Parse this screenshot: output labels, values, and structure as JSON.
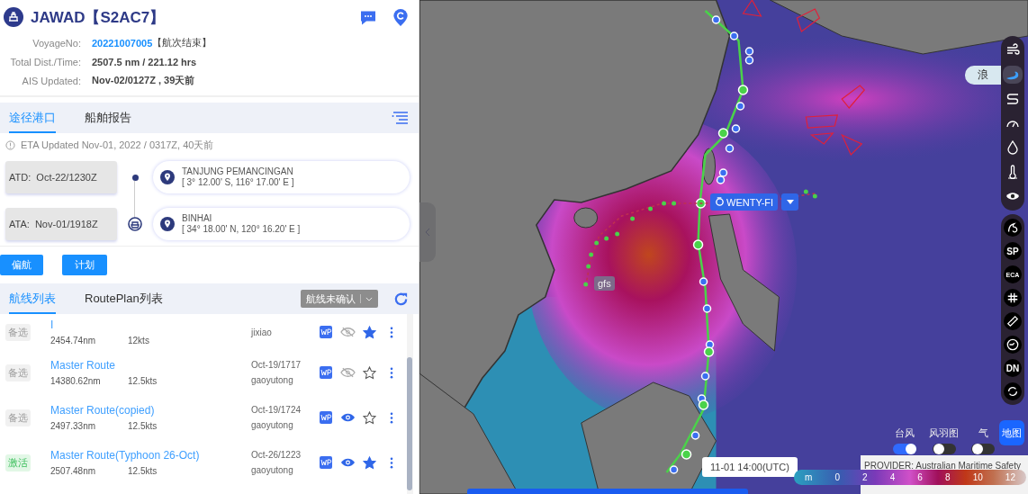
{
  "vessel": {
    "name": "JAWAD【S2AC7】"
  },
  "info": [
    {
      "label": "VoyageNo:",
      "value": "20221007005",
      "note": "【航次结束】",
      "kind": "link"
    },
    {
      "label": "Total Dist./Time:",
      "value": "2507.5 nm / 221.12 hrs",
      "kind": "plain"
    },
    {
      "label": "AIS Updated:",
      "value": "Nov-02/0127Z , 39天前",
      "kind": "plain"
    }
  ],
  "port_tabs": [
    {
      "label": "途径港口",
      "selected": true
    },
    {
      "label": "船舶报告",
      "selected": false
    }
  ],
  "eta_note": "ETA Updated Nov-01, 2022 / 0317Z, 40天前",
  "ports": [
    {
      "time_label": "ATD:",
      "time": "Oct-22/1230Z",
      "name": "TANJUNG PEMANCINGAN",
      "coords": "[ 3° 12.00' S, 116° 17.00' E ]",
      "kind": "origin"
    },
    {
      "time_label": "ATA:",
      "time": "Nov-01/1918Z",
      "name": "BINHAI",
      "coords": "[ 34° 18.00' N, 120° 16.20' E ]",
      "kind": "ship"
    }
  ],
  "actions": [
    "偏航",
    "计划"
  ],
  "route_tabs": [
    {
      "label": "航线列表",
      "selected": true
    },
    {
      "label": "RoutePlan列表",
      "selected": false
    }
  ],
  "route_filter": "航线未确认",
  "routes": [
    {
      "status": "备选",
      "kind": "standby",
      "name": "I",
      "distance": "2454.74nm",
      "speed": "12kts",
      "user": "jixiao",
      "visible": false,
      "starred": true
    },
    {
      "status": "备选",
      "kind": "standby",
      "name": "Master Route",
      "distance": "14380.62nm",
      "speed": "12.5kts",
      "date": "Oct-19/1717",
      "user": "gaoyutong",
      "visible": false,
      "starred": false
    },
    {
      "status": "备选",
      "kind": "standby",
      "name": "Master Route(copied)",
      "distance": "2497.33nm",
      "speed": "12.5kts",
      "date": "Oct-19/1724",
      "user": "gaoyutong",
      "visible": true,
      "starred": false
    },
    {
      "status": "激活",
      "kind": "active",
      "name": "Master Route(Typhoon 26-Oct)",
      "distance": "2507.48nm",
      "speed": "12.5kts",
      "date": "Oct-26/1223",
      "user": "gaoyutong",
      "visible": true,
      "starred": true
    }
  ],
  "map": {
    "typhoon_label": "WENTY-FI",
    "model_label": "gfs",
    "time_label": "11-01 14:00(UTC)",
    "layers": [
      {
        "kind": "wind",
        "selected": false
      },
      {
        "kind": "wave",
        "selected": true,
        "tooltip": "浪"
      },
      {
        "kind": "current",
        "selected": false
      },
      {
        "kind": "gauge",
        "selected": false
      },
      {
        "kind": "rain",
        "selected": false
      },
      {
        "kind": "temperature",
        "selected": false
      },
      {
        "kind": "visibility",
        "selected": false
      }
    ],
    "tools": [
      {
        "kind": "typhoon"
      },
      {
        "kind": "text",
        "label": "SP"
      },
      {
        "kind": "text",
        "label": "ECA"
      },
      {
        "kind": "grid"
      },
      {
        "kind": "ruler"
      },
      {
        "kind": "clock"
      },
      {
        "kind": "text",
        "label": "DN"
      },
      {
        "kind": "refresh"
      }
    ],
    "toggles": [
      {
        "label": "台风",
        "on": true
      },
      {
        "label": "风羽图",
        "on": false
      },
      {
        "label": "气",
        "on": false
      }
    ],
    "base_map_button": "地图",
    "provider": "PROVIDER: Australian Maritime Safety",
    "legend": {
      "unit": "m",
      "ticks": [
        "0",
        "2",
        "4",
        "6",
        "8",
        "10",
        "12"
      ]
    }
  }
}
